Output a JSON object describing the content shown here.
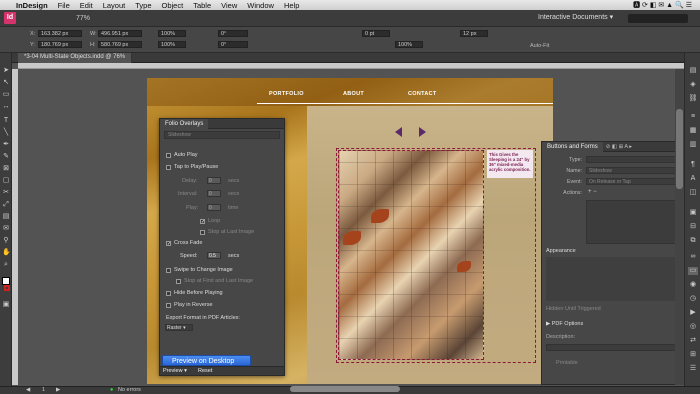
{
  "menubar": {
    "apple": "",
    "app": "InDesign",
    "items": [
      "File",
      "Edit",
      "Layout",
      "Type",
      "Object",
      "Table",
      "View",
      "Window",
      "Help"
    ],
    "right": "🅰  ⟳  ◧  ✉  ▲  🔍  ☰"
  },
  "appbar": {
    "logo": "Id",
    "zoom": "77%",
    "workspace": "Interactive Documents ▾",
    "search_placeholder": ""
  },
  "control": {
    "x": "163.382 px",
    "y": "180.769 px",
    "w": "496.951 px",
    "h": "580.769 px",
    "scale_x": "100%",
    "scale_y": "100%",
    "rotate": "0°",
    "shear": "0°",
    "stroke": "0 pt",
    "width": "12 px",
    "pct": "100%",
    "autofit": "Auto-Fit"
  },
  "document": {
    "tab": "*3-04 Multi-State Objects.indd @ 76%"
  },
  "page": {
    "nav": [
      "PORTFOLIO",
      "ABOUT",
      "CONTACT"
    ],
    "caption": "This Gives the Sleeping is a 24\" by 36\" mixed-media acrylic composition."
  },
  "folio": {
    "title": "Folio Overlays",
    "object": "Slideshow",
    "auto_play": "Auto Play",
    "tap": "Tap to Play/Pause",
    "delay_label": "Delay:",
    "delay_value": "0",
    "delay_unit": "secs",
    "interval_label": "Interval:",
    "interval_value": "0",
    "interval_unit": "secs",
    "play_label": "Play:",
    "play_value": "0",
    "play_unit": "time",
    "loop": "Loop",
    "stop_last": "Stop at Last Image",
    "crossfade": "Cross Fade",
    "speed_label": "Speed:",
    "speed_value": "0.5",
    "speed_unit": "secs",
    "swipe": "Swipe to Change Image",
    "stop_first_last": "Stop at First and Last Image",
    "hide_before": "Hide Before Playing",
    "play_reverse": "Play in Reverse",
    "export_label": "Export Format in PDF Articles:",
    "export_value": "Raster ▾",
    "preview": "Preview ▾",
    "reset": "Reset"
  },
  "tooltip": "Preview on Desktop",
  "bnf": {
    "title": "Buttons and Forms",
    "tab_icons": "⊘ ◧ ⊞ A ▸",
    "type_label": "Type:",
    "type_value": "",
    "name_label": "Name:",
    "name_value": "Slideshow",
    "event_label": "Event:",
    "event_value": "On Release or Tap",
    "actions_label": "Actions:",
    "actions_icons": "+  −",
    "appearance": "Appearance",
    "hidden_until": "Hidden Until Triggered",
    "pdf_options": "▶ PDF Options",
    "description": "Description:",
    "printable": "Printable"
  },
  "status": {
    "page": "1",
    "errors": "No errors"
  }
}
